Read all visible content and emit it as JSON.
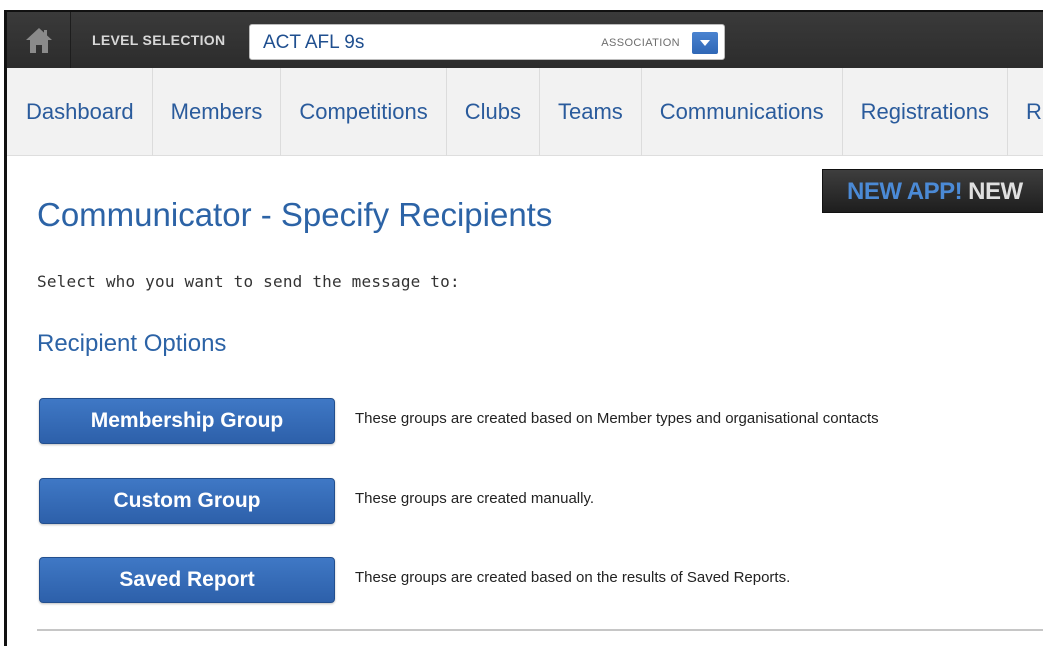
{
  "header": {
    "level_label": "LEVEL SELECTION",
    "level_value": "ACT AFL 9s",
    "level_type": "ASSOCIATION"
  },
  "nav": {
    "items": [
      "Dashboard",
      "Members",
      "Competitions",
      "Clubs",
      "Teams",
      "Communications",
      "Registrations",
      "R"
    ]
  },
  "banner": {
    "part1": "NEW APP!",
    "part2": "NEW"
  },
  "main": {
    "title": "Communicator - Specify Recipients",
    "instruction": "Select who you want to send the message to:",
    "section_title": "Recipient Options",
    "options": [
      {
        "label": "Membership Group",
        "description": "These groups are created based on Member types and organisational contacts"
      },
      {
        "label": "Custom Group",
        "description": "These groups are created manually."
      },
      {
        "label": "Saved Report",
        "description": "These groups are created based on the results of Saved Reports."
      }
    ]
  },
  "colors": {
    "accent": "#2c63a6",
    "button": "#3469b4",
    "topbar": "#333333"
  },
  "icons": [
    "home-icon",
    "chevron-down-icon"
  ]
}
